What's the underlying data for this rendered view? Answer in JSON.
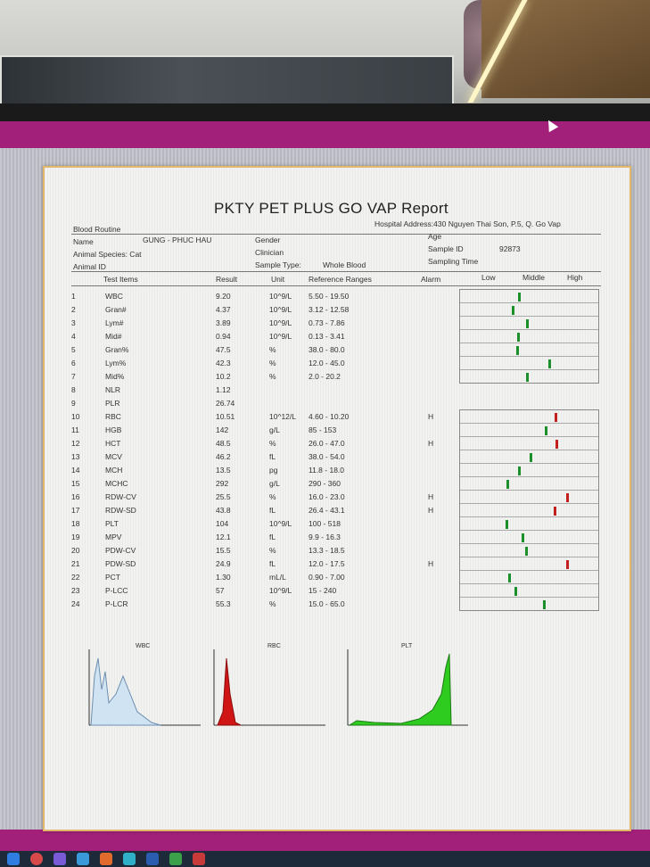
{
  "report": {
    "title": "PKTY PET PLUS GO VAP Report",
    "hospital_address": "Hospital Address:430 Nguyen Thai Son, P.5, Q. Go Vap",
    "section": "Blood Routine",
    "name_label": "Name",
    "name_value": "GUNG - PHUC HAU",
    "species_label": "Animal Species: Cat",
    "animal_id_label": "Animal ID",
    "gender_label": "Gender",
    "clinician_label": "Clinician",
    "sample_type_label": "Sample Type:",
    "sample_type_value": "Whole Blood",
    "age_label": "Age",
    "sample_id_label": "Sample ID",
    "sample_id_value": "92873",
    "sampling_time_label": "Sampling Time",
    "headers": {
      "test_items": "Test Items",
      "result": "Result",
      "unit": "Unit",
      "reference": "Reference Ranges",
      "alarm": "Alarm",
      "low": "Low",
      "middle": "Middle",
      "high": "High"
    },
    "rows": [
      {
        "n": "1",
        "item": "WBC",
        "result": "9.20",
        "unit": "10^9/L",
        "ref": "5.50 - 19.50",
        "alarm": ""
      },
      {
        "n": "2",
        "item": "Gran#",
        "result": "4.37",
        "unit": "10^9/L",
        "ref": "3.12 - 12.58",
        "alarm": ""
      },
      {
        "n": "3",
        "item": "Lym#",
        "result": "3.89",
        "unit": "10^9/L",
        "ref": "0.73 - 7.86",
        "alarm": ""
      },
      {
        "n": "4",
        "item": "Mid#",
        "result": "0.94",
        "unit": "10^9/L",
        "ref": "0.13 - 3.41",
        "alarm": ""
      },
      {
        "n": "5",
        "item": "Gran%",
        "result": "47.5",
        "unit": "%",
        "ref": "38.0 - 80.0",
        "alarm": ""
      },
      {
        "n": "6",
        "item": "Lym%",
        "result": "42.3",
        "unit": "%",
        "ref": "12.0 - 45.0",
        "alarm": ""
      },
      {
        "n": "7",
        "item": "Mid%",
        "result": "10.2",
        "unit": "%",
        "ref": "2.0 - 20.2",
        "alarm": ""
      },
      {
        "n": "8",
        "item": "NLR",
        "result": "1.12",
        "unit": "",
        "ref": "",
        "alarm": ""
      },
      {
        "n": "9",
        "item": "PLR",
        "result": "26.74",
        "unit": "",
        "ref": "",
        "alarm": ""
      },
      {
        "n": "10",
        "item": "RBC",
        "result": "10.51",
        "unit": "10^12/L",
        "ref": "4.60 - 10.20",
        "alarm": "H"
      },
      {
        "n": "11",
        "item": "HGB",
        "result": "142",
        "unit": "g/L",
        "ref": "85 - 153",
        "alarm": ""
      },
      {
        "n": "12",
        "item": "HCT",
        "result": "48.5",
        "unit": "%",
        "ref": "26.0 - 47.0",
        "alarm": "H"
      },
      {
        "n": "13",
        "item": "MCV",
        "result": "46.2",
        "unit": "fL",
        "ref": "38.0 - 54.0",
        "alarm": ""
      },
      {
        "n": "14",
        "item": "MCH",
        "result": "13.5",
        "unit": "pg",
        "ref": "11.8 - 18.0",
        "alarm": ""
      },
      {
        "n": "15",
        "item": "MCHC",
        "result": "292",
        "unit": "g/L",
        "ref": "290 - 360",
        "alarm": ""
      },
      {
        "n": "16",
        "item": "RDW-CV",
        "result": "25.5",
        "unit": "%",
        "ref": "16.0 - 23.0",
        "alarm": "H"
      },
      {
        "n": "17",
        "item": "RDW-SD",
        "result": "43.8",
        "unit": "fL",
        "ref": "26.4 - 43.1",
        "alarm": "H"
      },
      {
        "n": "18",
        "item": "PLT",
        "result": "104",
        "unit": "10^9/L",
        "ref": "100 - 518",
        "alarm": ""
      },
      {
        "n": "19",
        "item": "MPV",
        "result": "12.1",
        "unit": "fL",
        "ref": "9.9 - 16.3",
        "alarm": ""
      },
      {
        "n": "20",
        "item": "PDW-CV",
        "result": "15.5",
        "unit": "%",
        "ref": "13.3 - 18.5",
        "alarm": ""
      },
      {
        "n": "21",
        "item": "PDW-SD",
        "result": "24.9",
        "unit": "fL",
        "ref": "12.0 - 17.5",
        "alarm": "H"
      },
      {
        "n": "22",
        "item": "PCT",
        "result": "1.30",
        "unit": "mL/L",
        "ref": "0.90 - 7.00",
        "alarm": ""
      },
      {
        "n": "23",
        "item": "P-LCC",
        "result": "57",
        "unit": "10^9/L",
        "ref": "15 - 240",
        "alarm": ""
      },
      {
        "n": "24",
        "item": "P-LCR",
        "result": "55.3",
        "unit": "%",
        "ref": "15.0 - 65.0",
        "alarm": ""
      }
    ],
    "histograms": [
      {
        "label": "WBC",
        "color": "#cfe3f2",
        "ticks": [
          "0",
          "100",
          "200",
          "300"
        ]
      },
      {
        "label": "RBC",
        "color": "#d01515",
        "ticks": [
          "0",
          "100"
        ]
      },
      {
        "label": "PLT",
        "color": "#2ecc1f",
        "ticks": [
          "0",
          "10",
          "20",
          "30"
        ]
      }
    ]
  }
}
